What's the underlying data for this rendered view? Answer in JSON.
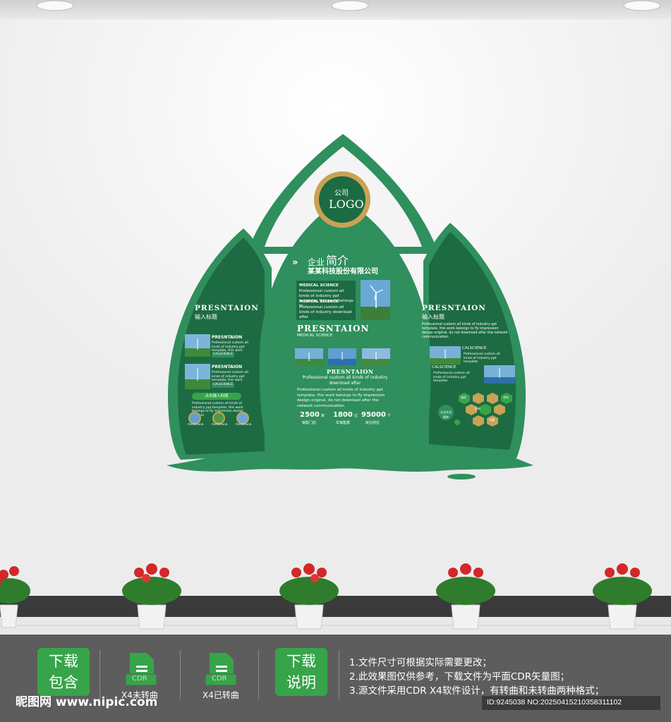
{
  "colors": {
    "dark_green": "#1c6b43",
    "mid_green": "#2f8f5d",
    "light_green": "#37a449",
    "gold": "#c9a253",
    "bar_gray": "#5d5d5d"
  },
  "logo": {
    "line1": "公司",
    "line2": "LOGO"
  },
  "center": {
    "title_prefix": "企业",
    "title_main": "简介",
    "company": "某某科技股份有限公司",
    "info_blocks": [
      {
        "label": "MEDICAL SCIENCE",
        "text": "Professional custom all kinds of industry ppt template, this work belongs to"
      },
      {
        "label": "MEDICAL SCIENCE",
        "text": "Professional custom all kinds of industry download after"
      }
    ],
    "heading": "PRESNTAION",
    "subheading": "MEDICAL SCIENCE",
    "sub_title": "PRESNTAION",
    "sub_text": "Professional custom all kinds of industry download after",
    "paragraph": "Professional custom all kinds of industry ppt template, this work belongs to fly impression design original, do not download after the network communication.",
    "stats": [
      {
        "value": "2500",
        "unit": "家",
        "label": "销售门店"
      },
      {
        "value": "1800",
        "unit": "亿",
        "label": "年销售额"
      },
      {
        "value": "95000",
        "unit": "个",
        "label": "就业岗位"
      }
    ]
  },
  "left": {
    "title": "PRESNTAION",
    "subtitle": "输入标题",
    "items": [
      {
        "title": "PRESNTAION",
        "text": "Professional custom all kinds of industry ppt template, this work belongs to",
        "tag": "CALSCIENCE"
      },
      {
        "title": "PRESNTAION",
        "text": "Professional custom all kinds of industry ppt template, this work belongs to",
        "tag": "CALSCIENCE"
      }
    ],
    "pill": "点击输入标题",
    "pill_text": "Professional custom all kinds of industry ppt template, this work belongs to fly impression design original",
    "circles": [
      "PRESNTAION",
      "PRESNTAION",
      "PRESNTAION"
    ]
  },
  "right": {
    "title": "PRESNTAION",
    "subtitle": "输入标题",
    "text": "Professional custom all kinds of industry ppt template, this work belongs to fly impression design original, do not download after the network communication.",
    "items": [
      {
        "label": "CALSCIENCE",
        "text": "Professional custom all kinds of industry ppt template"
      },
      {
        "label": "CALSCIENCE",
        "text": "Professional custom all kinds of industry ppt template"
      }
    ],
    "hex_labels": [
      "诚信",
      "创新",
      "合作",
      "共赢",
      "企业文化",
      "精神"
    ]
  },
  "footer": {
    "download_includes": [
      "下载",
      "包含"
    ],
    "file1": {
      "icon": "CDR",
      "label": "X4未转曲"
    },
    "file2": {
      "icon": "CDR",
      "label": "X4已转曲"
    },
    "download_notes": [
      "下载",
      "说明"
    ],
    "notes": [
      "1.文件尺寸可根据实际需要更改；",
      "2.此效果图仅供参考，下载文件为平面CDR矢量图；",
      "3.源文件采用CDR X4软件设计，有转曲和未转曲两种格式；"
    ],
    "watermark": "昵图网 www.nipic.com",
    "id_line": "ID:9245038 NO:20250415210358311102"
  }
}
